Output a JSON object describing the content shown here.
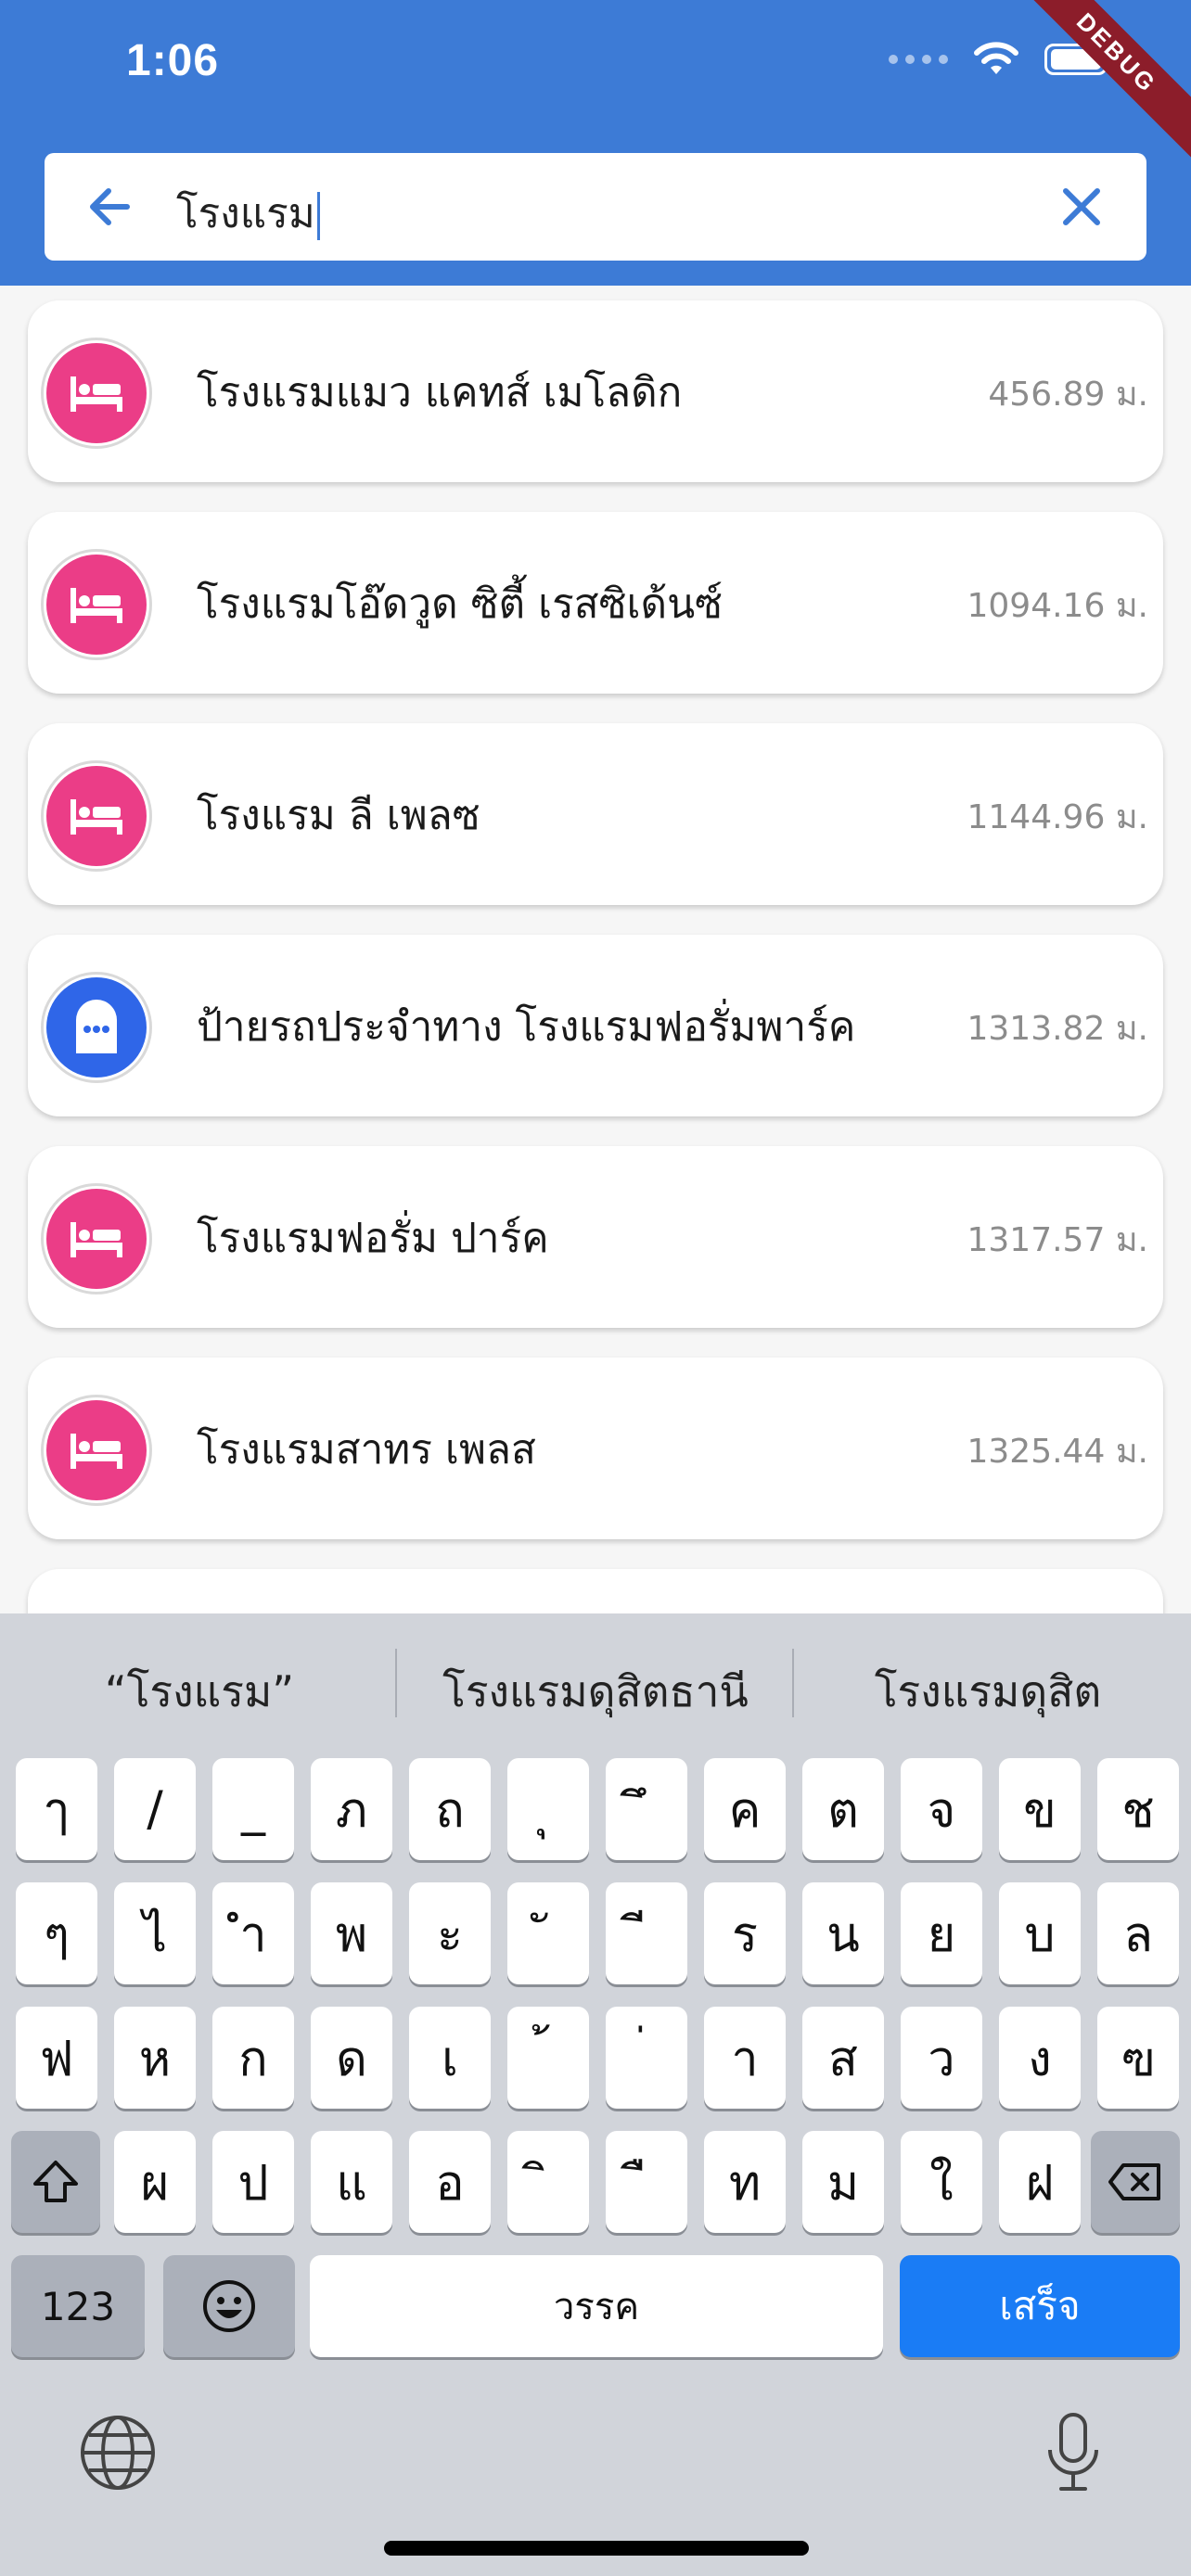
{
  "status": {
    "time": "1:06"
  },
  "debug_label": "DEBUG",
  "search": {
    "value": "โรงแรม"
  },
  "results": [
    {
      "icon": "hotel-icon",
      "kind": "hotel",
      "title": "โรงแรมแมว แคทส์ เมโลดิก",
      "distance": "456.89 ม."
    },
    {
      "icon": "hotel-icon",
      "kind": "hotel",
      "title": "โรงแรมโอ๊ดวูด ซิตี้ เรสซิเด้นซ์",
      "distance": "1094.16 ม."
    },
    {
      "icon": "hotel-icon",
      "kind": "hotel",
      "title": "โรงแรม ลี เพลซ",
      "distance": "1144.96 ม."
    },
    {
      "icon": "bus-stop-icon",
      "kind": "bus",
      "title": "ป้ายรถประจำทาง โรงแรมฟอรั่มพาร์ค",
      "distance": "1313.82 ม."
    },
    {
      "icon": "hotel-icon",
      "kind": "hotel",
      "title": "โรงแรมฟอรั่ม ปาร์ค",
      "distance": "1317.57 ม."
    },
    {
      "icon": "hotel-icon",
      "kind": "hotel",
      "title": "โรงแรมสาทร เพลส",
      "distance": "1325.44 ม."
    }
  ],
  "keyboard": {
    "suggestions": [
      "“โรงแรม”",
      "โรงแรมดุสิตธานี",
      "โรงแรมดุสิต"
    ],
    "row1": [
      "ๅ",
      "/",
      "_",
      "ภ",
      "ถ",
      "ุ",
      "ึ",
      "ค",
      "ต",
      "จ",
      "ข",
      "ช"
    ],
    "row2": [
      "ๆ",
      "ไ",
      "ำ",
      "พ",
      "ะ",
      "ั",
      "ี",
      "ร",
      "น",
      "ย",
      "บ",
      "ล"
    ],
    "row3": [
      "ฟ",
      "ห",
      "ก",
      "ด",
      "เ",
      "้",
      "่",
      "า",
      "ส",
      "ว",
      "ง",
      "ฃ"
    ],
    "row4": [
      "ผ",
      "ป",
      "แ",
      "อ",
      "ิ",
      "ื",
      "ท",
      "ม",
      "ใ",
      "ฝ"
    ],
    "numbers_label": "123",
    "space_label": "วรรค",
    "done_label": "เสร็จ"
  }
}
